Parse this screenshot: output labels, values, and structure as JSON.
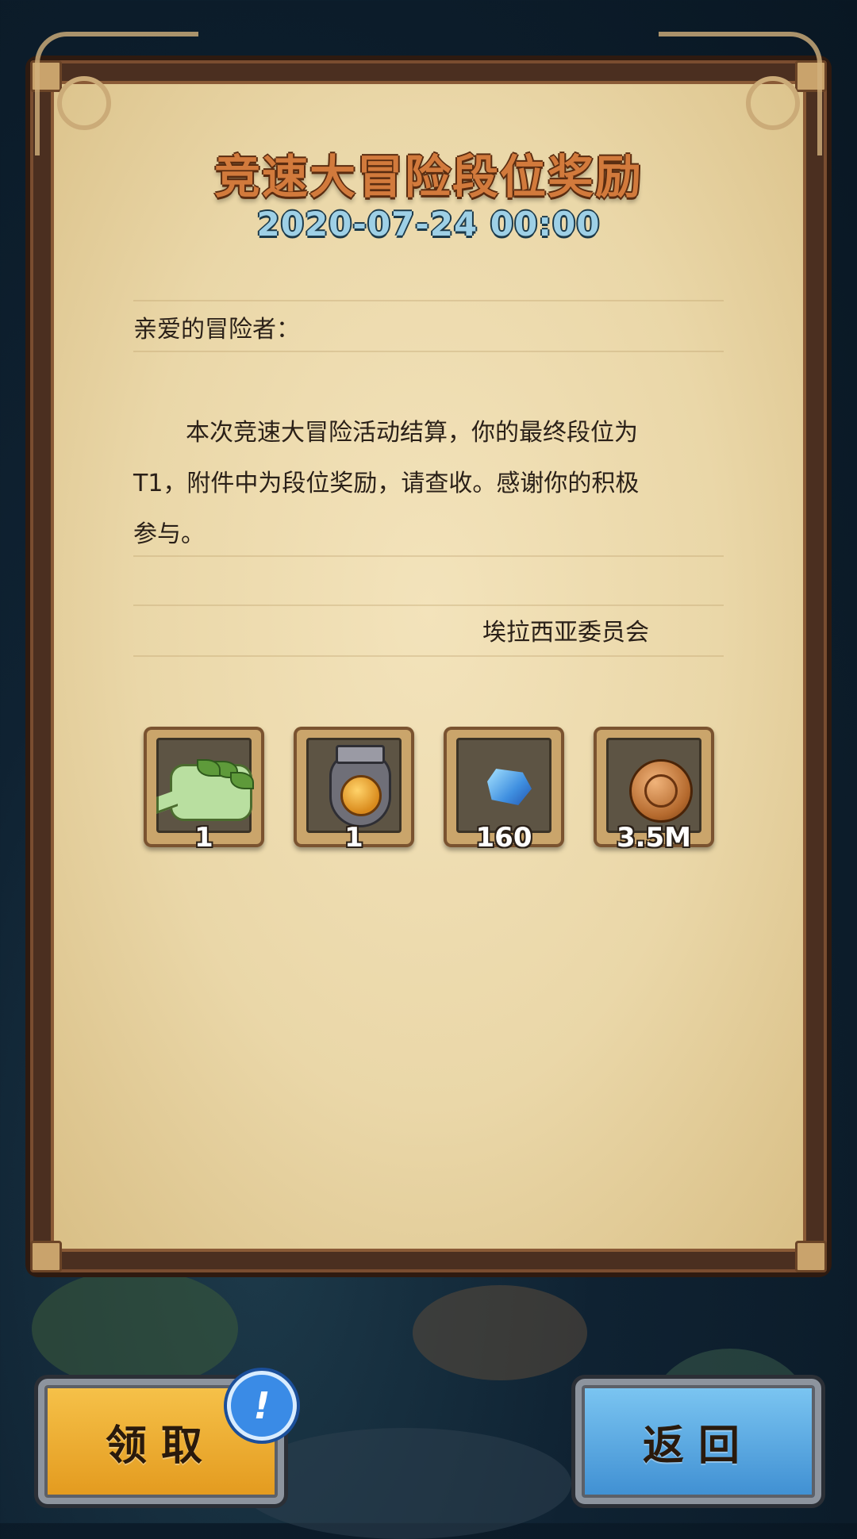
{
  "mail": {
    "title": "竞速大冒险段位奖励",
    "date": "2020-07-24 00:00",
    "greeting": "亲爱的冒险者：",
    "body": "本次竞速大冒险活动结算，你的最终段位为T1，附件中为段位奖励，请查收。感谢你的积极参与。",
    "signature": "埃拉西亚委员会"
  },
  "rewards": [
    {
      "icon": "vine-speech-bubble-icon",
      "count": "1"
    },
    {
      "icon": "medal-icon",
      "count": "1"
    },
    {
      "icon": "blue-crystal-icon",
      "count": "160"
    },
    {
      "icon": "gold-coin-icon",
      "count": "3.5M"
    }
  ],
  "buttons": {
    "claim_label": "领取",
    "back_label": "返回",
    "notification_mark": "!"
  },
  "colors": {
    "title": "#d27a3c",
    "date": "#9ed0e6",
    "claim_button": "#f0b23a",
    "back_button": "#5eaee6"
  }
}
